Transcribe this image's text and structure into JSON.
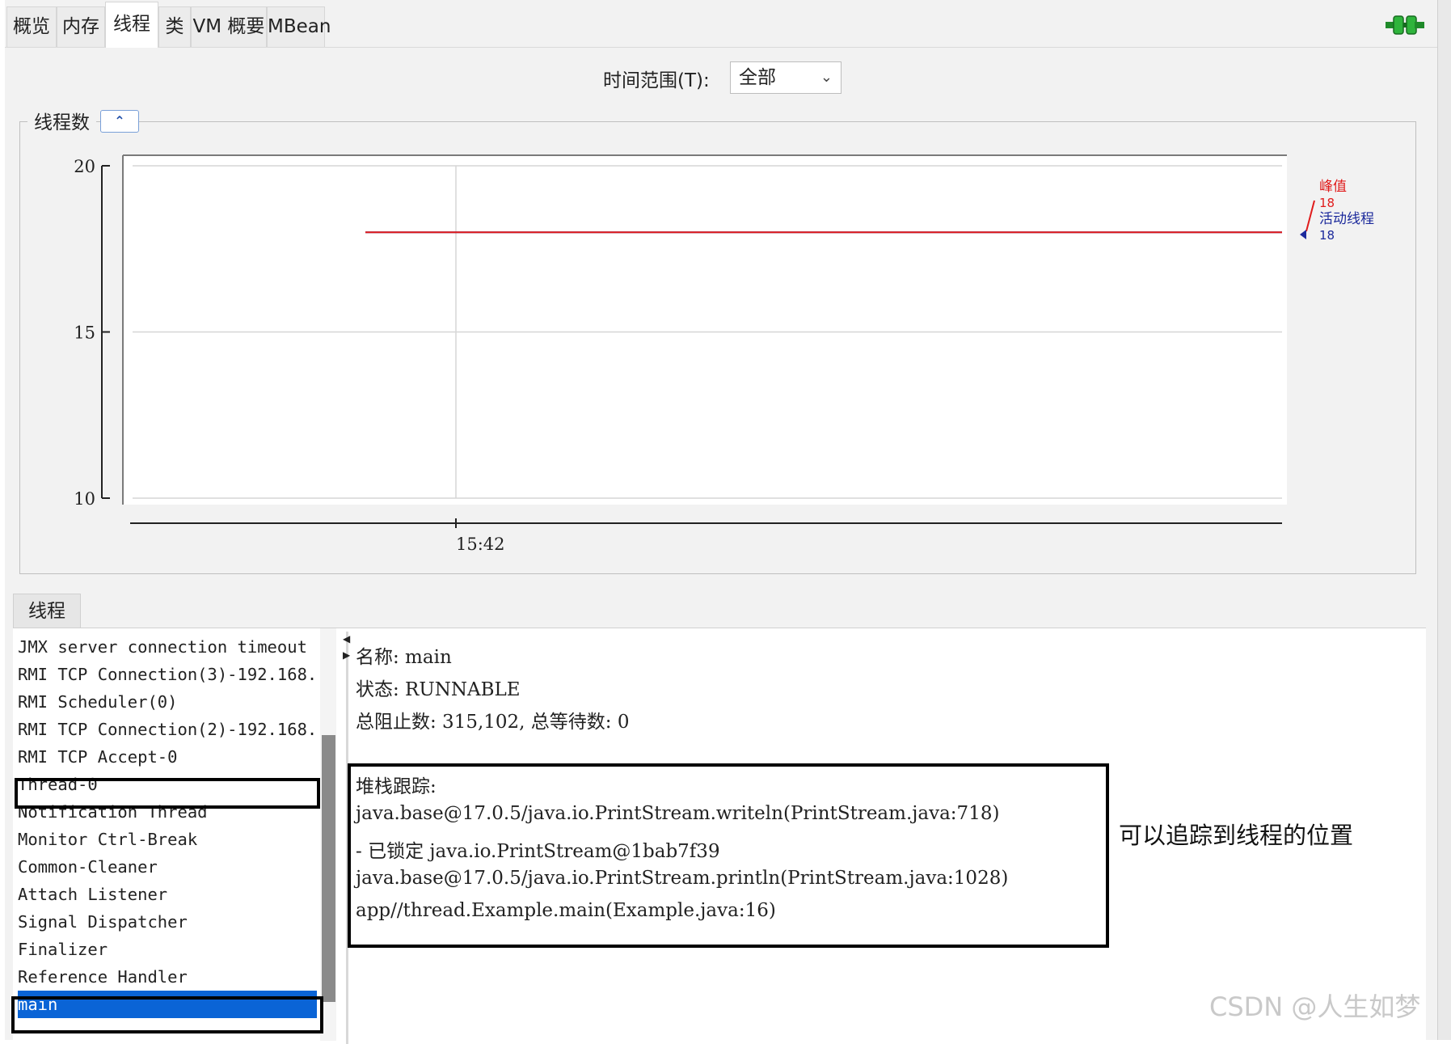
{
  "tabs": [
    "概览",
    "内存",
    "线程",
    "类",
    "VM 概要",
    "MBean"
  ],
  "active_tab": "线程",
  "time_range": {
    "label": "时间范围(T):",
    "value": "全部"
  },
  "chart": {
    "title": "线程数"
  },
  "chart_data": {
    "type": "line",
    "ylim": [
      10,
      20
    ],
    "yticks": [
      "20",
      "15",
      "10"
    ],
    "xticks": [
      "15:42"
    ],
    "series": [
      {
        "name": "峰值",
        "value": 18,
        "color": "#e01b1b"
      },
      {
        "name": "活动线程",
        "value": 18,
        "color": "#1c2a9c"
      }
    ],
    "legend": {
      "peak_label": "峰值",
      "peak_value": "18",
      "live_label": "活动线程",
      "live_value": "18"
    }
  },
  "threads_tab": "线程",
  "thread_list": {
    "items": [
      "JMX server connection timeout",
      "RMI TCP Connection(3)-192.168.",
      "RMI Scheduler(0)",
      "RMI TCP Connection(2)-192.168.",
      "RMI TCP Accept-0",
      "Thread-0",
      "Notification Thread",
      "Monitor Ctrl-Break",
      "Common-Cleaner",
      "Attach Listener",
      "Signal Dispatcher",
      "Finalizer",
      "Reference Handler",
      "main"
    ],
    "selected": "main"
  },
  "detail": {
    "name_line": "名称: main",
    "state_line": "状态: RUNNABLE",
    "counts_line": "总阻止数: 315,102, 总等待数: 0",
    "stack_header": "堆栈跟踪:",
    "stack": [
      "java.base@17.0.5/java.io.PrintStream.writeln(PrintStream.java:718)",
      "   - 已锁定 java.io.PrintStream@1bab7f39",
      "java.base@17.0.5/java.io.PrintStream.println(PrintStream.java:1028)",
      "app//thread.Example.main(Example.java:16)"
    ]
  },
  "annotation": "可以追踪到线程的位置",
  "watermark": "CSDN @人生如梦"
}
